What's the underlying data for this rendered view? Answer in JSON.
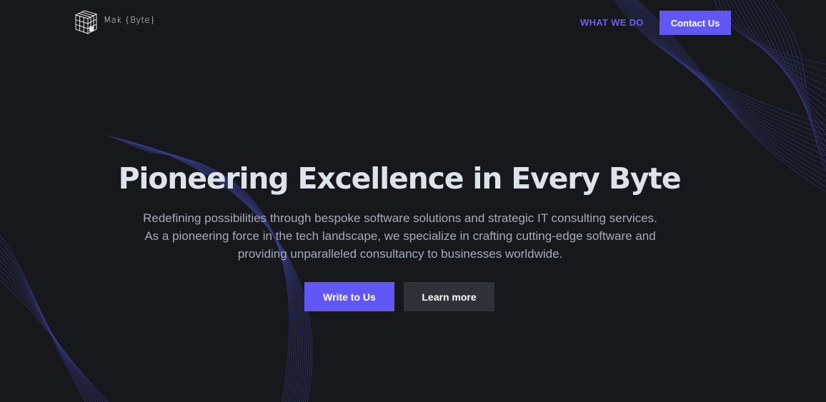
{
  "brand": {
    "name": "Mak {Byte}",
    "logo_icon": "cube-icon",
    "accent_color": "#6157f5",
    "background_color": "#17181b"
  },
  "nav": {
    "what_we_do": "WHAT WE DO",
    "contact_button": "Contact Us"
  },
  "hero": {
    "title": "Pioneering Excellence in Every Byte",
    "subtitle_lines": [
      "Redefining possibilities through bespoke software solutions and strategic IT consulting services.",
      "As a pioneering force in the tech landscape, we specialize in crafting cutting-edge software and",
      "providing unparalleled consultancy to businesses worldwide."
    ],
    "primary_button": "Write to Us",
    "secondary_button": "Learn more"
  }
}
